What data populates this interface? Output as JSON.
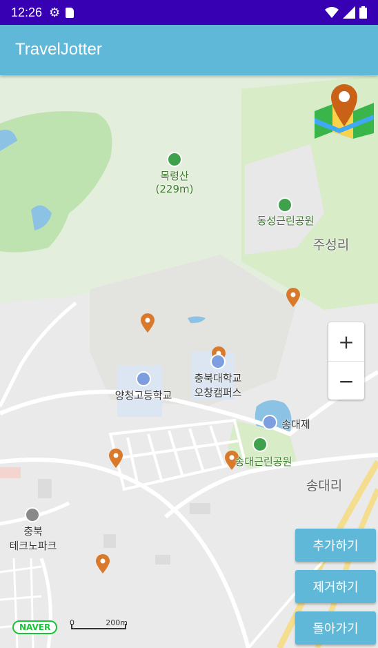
{
  "status_bar": {
    "time": "12:26"
  },
  "app": {
    "title": "TravelJotter"
  },
  "map": {
    "labels": {
      "mountain": "목령산",
      "mountain_height": "(229m)",
      "dongseong_park": "동성근린공원",
      "juseong_ri": "주성리",
      "yangcheong_school": "양청고등학교",
      "cbnu_line1": "충북대학교",
      "cbnu_line2": "오창캠퍼스",
      "songdaeje": "송대제",
      "songdae_park": "송대근린공원",
      "songdae_ri": "송대리",
      "technopark_line1": "충북",
      "technopark_line2": "테크노파크"
    },
    "naver_logo": "NAVER",
    "scale": {
      "zero": "0",
      "distance": "200m"
    }
  },
  "zoom": {
    "in": "+",
    "out": "−"
  },
  "buttons": {
    "add": "추가하기",
    "remove": "제거하기",
    "back": "돌아가기"
  },
  "colors": {
    "status_bar": "#3700b3",
    "app_bar": "#5fb8d8",
    "marker": "#d9792c",
    "park": "#bfe3b0"
  }
}
